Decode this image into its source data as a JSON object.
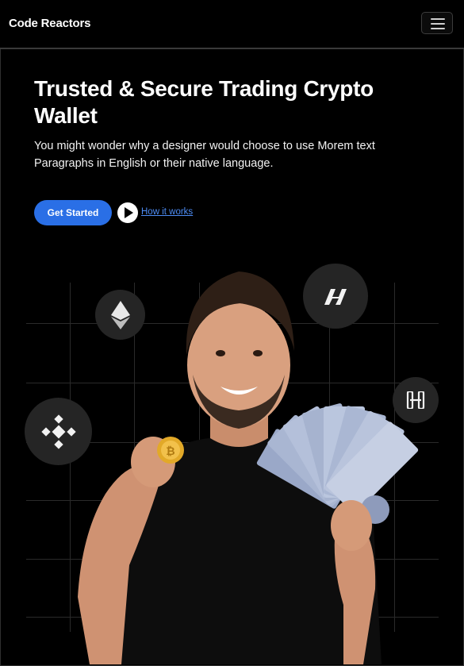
{
  "navbar": {
    "brand": "Code Reactors",
    "toggle_icon": "hamburger-menu-icon"
  },
  "hero": {
    "title": "Trusted & Secure Trading Crypto Wallet",
    "subtitle": "You might wonder why a designer would choose to use Morem text Paragraphs in English or their native language.",
    "primary_button": "Get Started",
    "secondary_link": "How it works",
    "secondary_icon": "play-icon"
  },
  "coins": [
    {
      "name": "ethereum-icon"
    },
    {
      "name": "harmony-icon"
    },
    {
      "name": "binance-icon"
    },
    {
      "name": "chainlink-icon"
    }
  ],
  "colors": {
    "background": "#000000",
    "accent": "#2a6fe6",
    "link": "#4d8cf5",
    "coin_badge": "#252525"
  }
}
